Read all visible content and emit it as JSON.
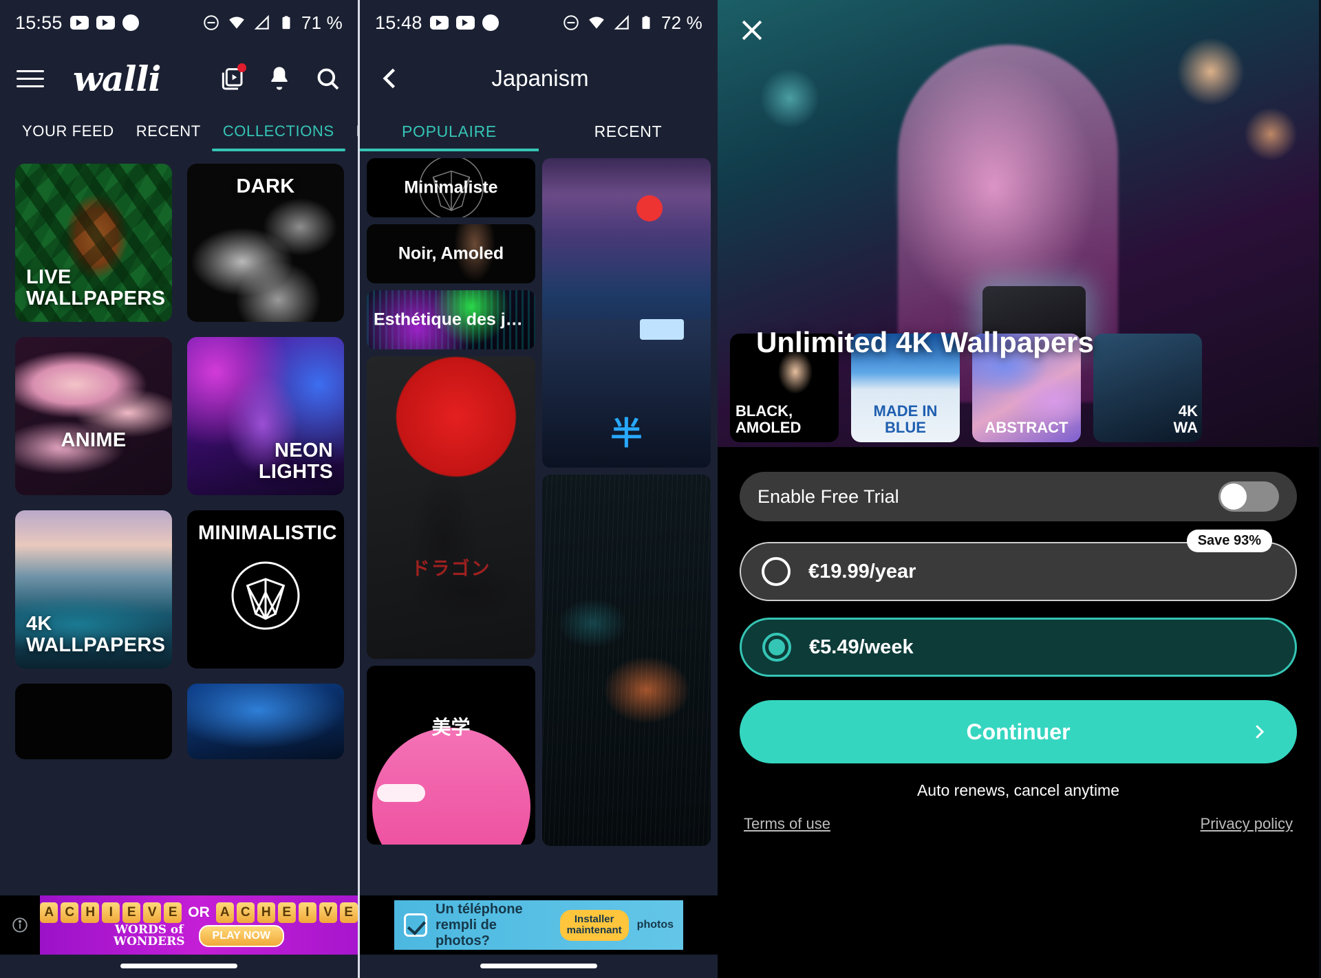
{
  "left_phone": {
    "status": {
      "time": "15:55",
      "battery": "71 %",
      "icons": [
        "youtube-icon",
        "youtube-icon",
        "record-dot-icon",
        "dnd-icon",
        "wifi-icon",
        "signal-icon",
        "battery-icon"
      ]
    },
    "appbar": {
      "brand": "walli",
      "menu_icon": "hamburger-icon",
      "library_icon": "library-icon",
      "bell_icon": "bell-icon",
      "search_icon": "search-icon",
      "badge": true
    },
    "tabs": [
      {
        "label": "YOUR FEED",
        "active": false
      },
      {
        "label": "RECENT",
        "active": false
      },
      {
        "label": "COLLECTIONS",
        "active": true
      },
      {
        "label": "POPULAIRE",
        "active": false
      }
    ],
    "cards": [
      {
        "title": "LIVE\nWALLPAPERS",
        "title_line1": "LIVE",
        "title_line2": "WALLPAPERS",
        "style": "fox",
        "align": "left"
      },
      {
        "title": "DARK",
        "style": "dark",
        "align": "center"
      },
      {
        "title": "ANIME",
        "style": "anime",
        "align": "center"
      },
      {
        "title_line1": "NEON",
        "title_line2": "LIGHTS",
        "style": "neon",
        "align": "right"
      },
      {
        "title_line1": "4K",
        "title_line2": "WALLPAPERS",
        "style": "fourk",
        "align": "left"
      },
      {
        "title": "MINIMALISTIC",
        "style": "minimal",
        "align": "center"
      },
      {
        "title": "",
        "style": "amoled2",
        "align": "center"
      },
      {
        "title": "",
        "style": "blue2",
        "align": "center"
      }
    ],
    "ad": {
      "letters_1": [
        "A",
        "C",
        "H",
        "I",
        "E",
        "V",
        "E"
      ],
      "or": "OR",
      "letters_2": [
        "A",
        "C",
        "H",
        "E",
        "I",
        "V",
        "E"
      ],
      "logo_line1": "WORDS of",
      "logo_line2": "WONDERS",
      "cta": "PLAY NOW",
      "info_icon": "info-icon"
    }
  },
  "mid_phone": {
    "status": {
      "time": "15:48",
      "battery": "72 %"
    },
    "appbar": {
      "back_icon": "chevron-left-icon",
      "title": "Japanism"
    },
    "tabs": [
      {
        "label": "POPULAIRE",
        "active": true
      },
      {
        "label": "RECENT",
        "active": false
      }
    ],
    "left_tiles": [
      {
        "label": "Minimaliste",
        "style": "min"
      },
      {
        "label": "Noir, Amoled",
        "style": "noir"
      },
      {
        "label": "Esthétique des jeux vi...",
        "style": "esth"
      },
      {
        "label": "ドラゴン",
        "style": "dragon"
      },
      {
        "label": "美学",
        "style": "pagoda"
      }
    ],
    "right_tiles": [
      {
        "label": "",
        "style": "street",
        "overlay_text": "半"
      },
      {
        "label": "",
        "style": "rain"
      }
    ],
    "ad": {
      "text_line1": "Un téléphone",
      "text_line2": "rempli de photos?",
      "cta_line1": "Installer",
      "cta_line2": "maintenant",
      "brand": "photos",
      "check_icon": "check-icon"
    }
  },
  "paywall": {
    "close_icon": "close-icon",
    "title": "Unlimited 4K Wallpapers",
    "thumbs": [
      {
        "label_line1": "BLACK,",
        "label_line2": "AMOLED",
        "style": "black"
      },
      {
        "label_line1": "MADE IN",
        "label_line2": "BLUE",
        "style": "blue"
      },
      {
        "label_line1": "ABSTRACT",
        "label_line2": "",
        "style": "abstract"
      },
      {
        "label_line1": "4K",
        "label_line2": "WA",
        "style": "fourk"
      }
    ],
    "trial": {
      "label": "Enable Free Trial",
      "enabled": false
    },
    "save_badge": "Save 93%",
    "plans": [
      {
        "label": "€19.99/year",
        "selected": false
      },
      {
        "label": "€5.49/week",
        "selected": true
      }
    ],
    "cta": {
      "label": "Continuer",
      "chevron_icon": "chevron-right-icon"
    },
    "renew_note": "Auto renews, cancel anytime",
    "terms_link": "Terms of use",
    "privacy_link": "Privacy policy",
    "accent_color": "#35d6c0",
    "selected_plan_border": "#35c5b5"
  }
}
